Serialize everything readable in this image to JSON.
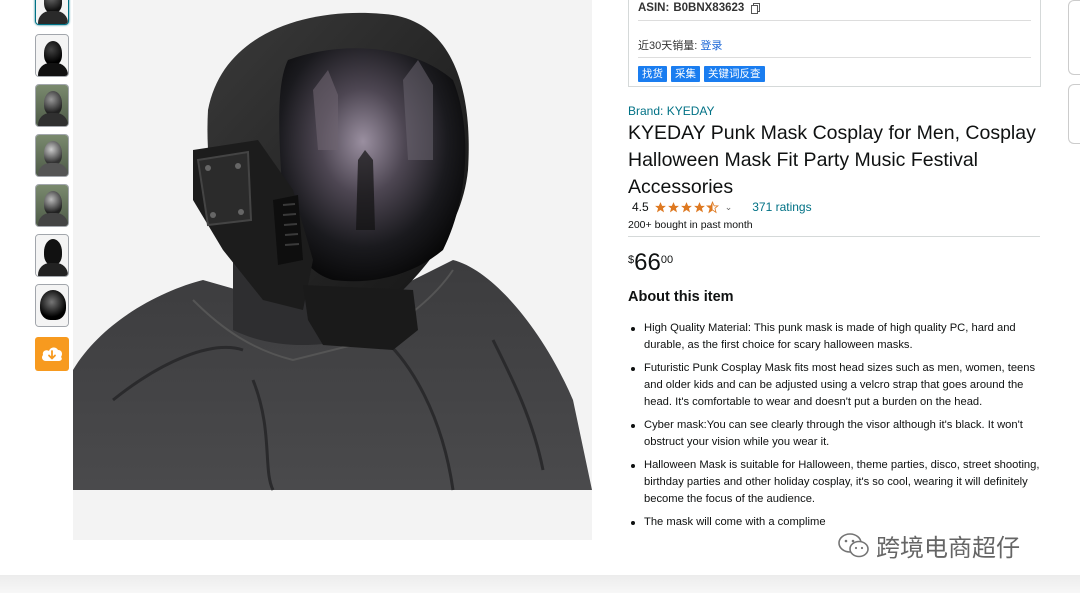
{
  "extension": {
    "asin_label": "ASIN:",
    "asin_value": "B0BNX83623",
    "sales_label": "近30天销量:",
    "sales_login": "登录",
    "buttons": [
      "找货",
      "采集",
      "关键词反查"
    ]
  },
  "product": {
    "brand": "Brand: KYEDAY",
    "title": "KYEDAY Punk Mask Cosplay for Men, Cosplay Halloween Mask Fit Party Music Festival Accessories",
    "rating_value": "4.5",
    "ratings_count": "371 ratings",
    "bought": "200+ bought in past month",
    "price_symbol": "$",
    "price_whole": "66",
    "price_fraction": "00",
    "about_heading": "About this item",
    "bullets": [
      "High Quality Material: This punk mask is made of high quality PC, hard and durable, as the first choice for scary halloween masks.",
      "Futuristic Punk Cosplay Mask fits most head sizes such as men, women, teens and older kids and can be adjusted using a velcro strap that goes around the head. It's comfortable to wear and doesn't put a burden on the head.",
      "Cyber mask:You can see clearly through the visor although it's black. It won't obstruct your vision while you wear it.",
      "Halloween Mask is suitable for Halloween, theme parties, disco, street shooting, birthday parties and other holiday cosplay, it's so cool, wearing it will definitely become the focus of the audience.",
      "The mask will come with a complime"
    ]
  },
  "thumbnails": [
    {
      "name": "thumb-1",
      "style": "dark"
    },
    {
      "name": "thumb-2",
      "style": "dark"
    },
    {
      "name": "thumb-3",
      "style": "green"
    },
    {
      "name": "thumb-4",
      "style": "green"
    },
    {
      "name": "thumb-5",
      "style": "green"
    },
    {
      "name": "thumb-6",
      "style": "white"
    },
    {
      "name": "thumb-7",
      "style": "white"
    }
  ],
  "watermark": "跨境电商超仔",
  "colors": {
    "link": "#007185",
    "star": "#de7921",
    "ext_button": "#1a7df0",
    "cloud_button": "#f79a1f"
  },
  "icons": {
    "cloud": "cloud-download-icon",
    "copy": "copy-icon",
    "star": "star-icon",
    "chevron": "chevron-down-icon",
    "wechat": "wechat-icon"
  }
}
